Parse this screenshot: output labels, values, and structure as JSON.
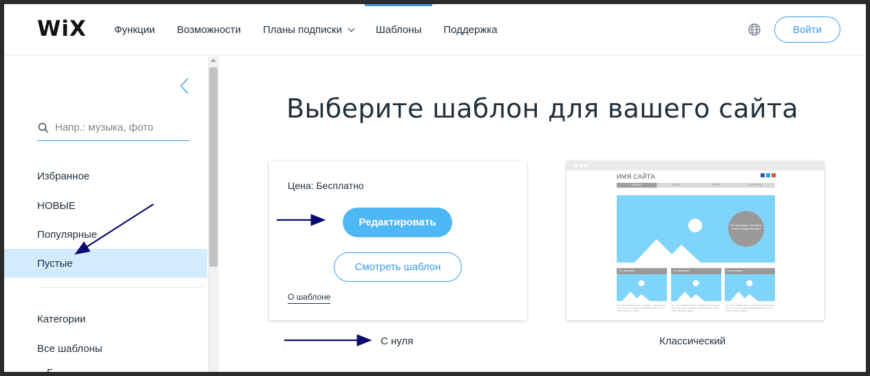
{
  "header": {
    "logo": "WiX",
    "nav": [
      {
        "label": "Функции",
        "active": false
      },
      {
        "label": "Возможности",
        "active": false
      },
      {
        "label": "Планы подписки",
        "active": false,
        "dropdown": true
      },
      {
        "label": "Шаблоны",
        "active": true
      },
      {
        "label": "Поддержка",
        "active": false
      }
    ],
    "language_icon": "globe-icon",
    "login_label": "Войти"
  },
  "sidebar": {
    "search_placeholder": "Напр.: музыка, фото",
    "links": {
      "favorites": "Избранное",
      "new": "НОВЫЕ",
      "popular": "Популярные",
      "blank": "Пустые",
      "categories": "Категории",
      "all_templates": "Все шаблоны",
      "partial": "Б"
    },
    "selected": "Пустые"
  },
  "main": {
    "title": "Выберите шаблон для вашего сайта",
    "card": {
      "price_label": "Цена:",
      "price_value": "Бесплатно",
      "edit_label": "Редактировать",
      "view_label": "Смотреть шаблон",
      "about_label": "О шаблоне",
      "caption": "С нуля"
    },
    "template": {
      "caption": "Классический",
      "thumb_site_name": "ИМЯ САЙТА",
      "thumb_menu": [
        "ГЛАВНАЯ",
        "О НАС",
        "УСЛУГИ",
        "КОНТАКТЫ"
      ],
      "thumb_circle_text": "Это заголовок. Нажмите, чтобы отредактировать",
      "thumb_box_label": "Это заголовок",
      "thumb_box_text": "Это текст. Нажмите здесь и добавьте собственный текст или просто нажмите «Редактировать текст», чтобы изменить шрифт."
    }
  },
  "colors": {
    "accent": "#3899ec",
    "selected_bg": "#d3ebff",
    "edit_button": "#4eb7f5",
    "annotation_arrow": "#0a0a6e"
  }
}
